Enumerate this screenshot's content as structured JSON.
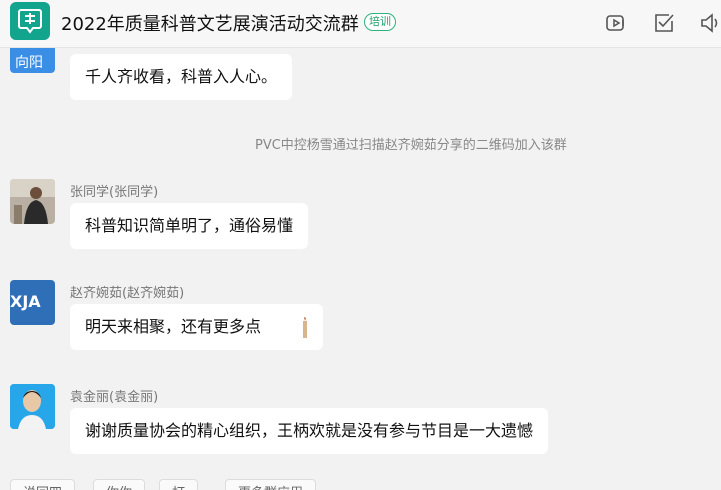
{
  "header": {
    "group_title": "2022年质量科普文艺展演活动交流群",
    "group_tag": "培训",
    "icons": [
      "group-avatar-icon",
      "video-call-icon",
      "check-task-icon",
      "speaker-icon"
    ]
  },
  "messages": [
    {
      "avatar_text": "向阳",
      "text": "千人齐收看，科普入人心。"
    },
    {
      "sender": "张同学(张同学)",
      "text": "科普知识简单明了，通俗易懂"
    },
    {
      "sender": "赵齐婉茹(赵齐婉茹)",
      "avatar_text": "XJA",
      "text": "明天来相聚，还有更多点"
    },
    {
      "sender": "袁金丽(袁金丽)",
      "text": "谢谢质量协会的精心组织，王柄欢就是没有参与节目是一大遗憾"
    }
  ],
  "system_notice": "PVC中控杨雪通过扫描赵齐婉茹分享的二维码加入该群",
  "quick_replies": [
    "说回四",
    "你你",
    "打",
    "更多群应用"
  ],
  "colors": {
    "accent": "#12a48c",
    "tag": "#2eb37a",
    "bubble": "#ffffff",
    "background": "#f2f2f2"
  }
}
